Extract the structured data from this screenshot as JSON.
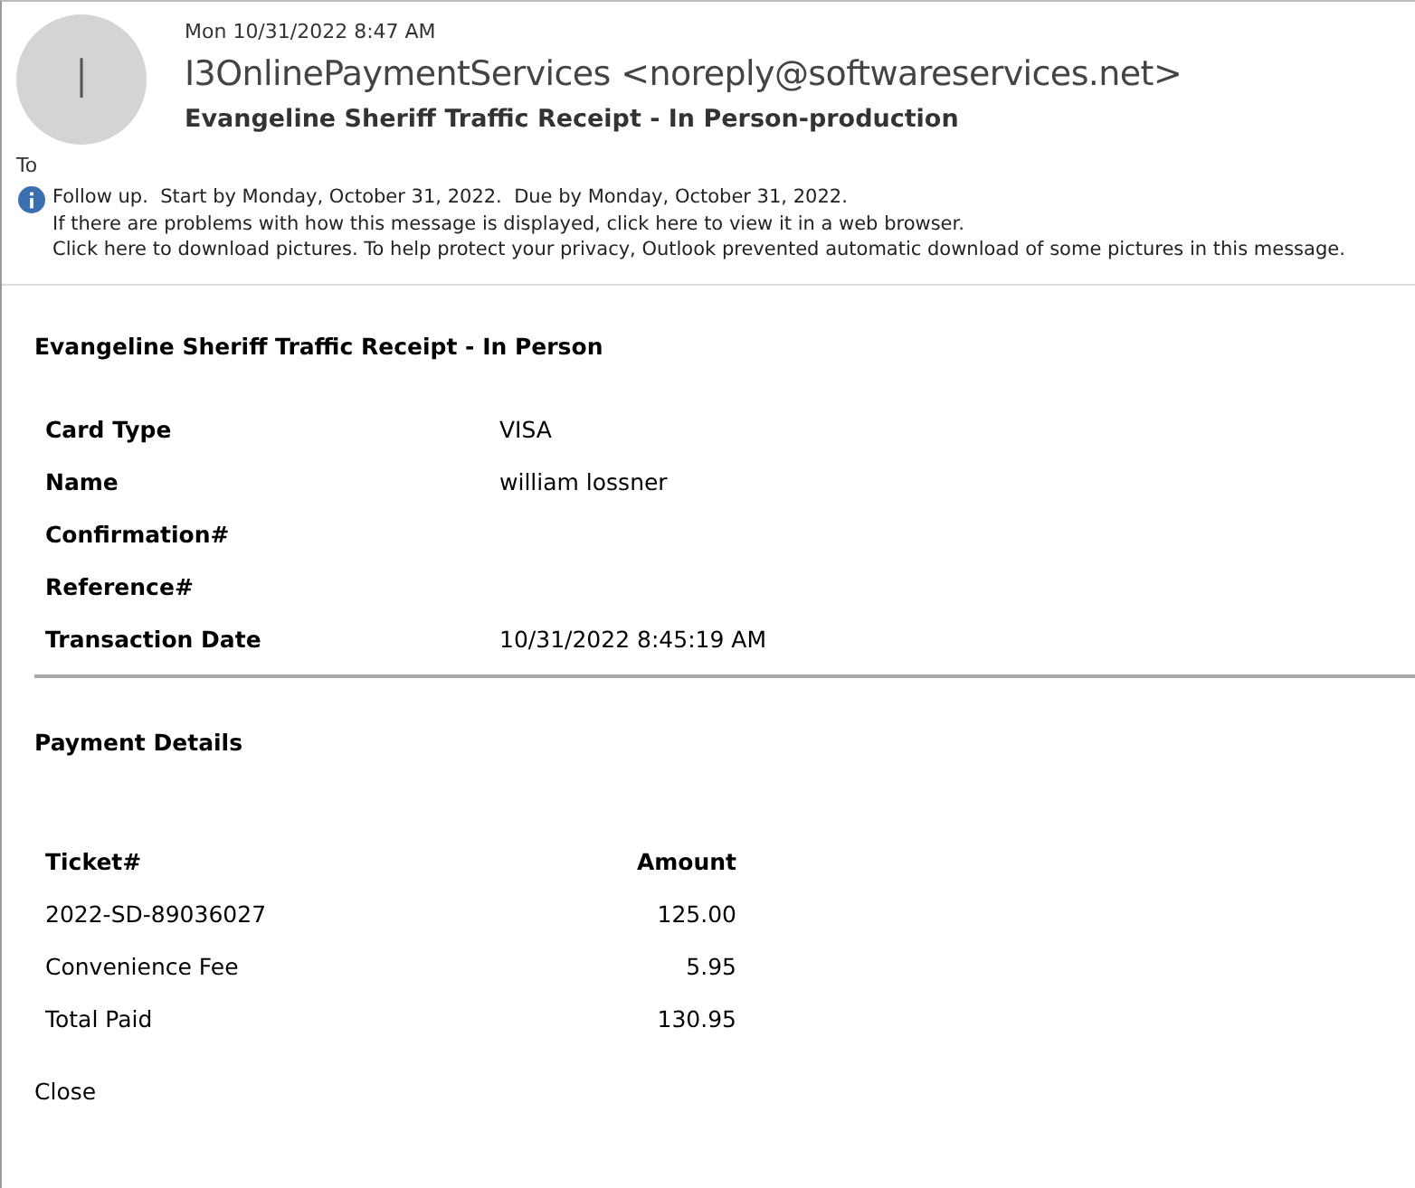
{
  "header": {
    "avatar_initial": "I",
    "date": "Mon 10/31/2022 8:47 AM",
    "sender": "I3OnlinePaymentServices <noreply@softwareservices.net>",
    "subject": "Evangeline Sheriff Traffic Receipt - In Person-production",
    "to_label": "To"
  },
  "infobar": {
    "lines": [
      "Follow up.  Start by Monday, October 31, 2022.  Due by Monday, October 31, 2022.",
      "If there are problems with how this message is displayed, click here to view it in a web browser.",
      "Click here to download pictures. To help protect your privacy, Outlook prevented automatic download of some pictures in this message."
    ]
  },
  "body": {
    "title": "Evangeline Sheriff Traffic Receipt - In Person",
    "details": [
      {
        "label": "Card Type",
        "value": "VISA"
      },
      {
        "label": "Name",
        "value": "william lossner"
      },
      {
        "label": "Confirmation#"
      },
      {
        "label": "Reference#"
      },
      {
        "label": "Transaction Date",
        "value": "10/31/2022 8:45:19 AM"
      }
    ],
    "payment_title": "Payment Details",
    "payment_columns": [
      "Ticket#",
      "Amount"
    ],
    "payment_rows": [
      [
        "2022-SD-89036027",
        "125.00"
      ],
      [
        "Convenience Fee",
        "5.95"
      ],
      [
        "Total Paid",
        "130.95"
      ]
    ],
    "close_link": "Close"
  }
}
